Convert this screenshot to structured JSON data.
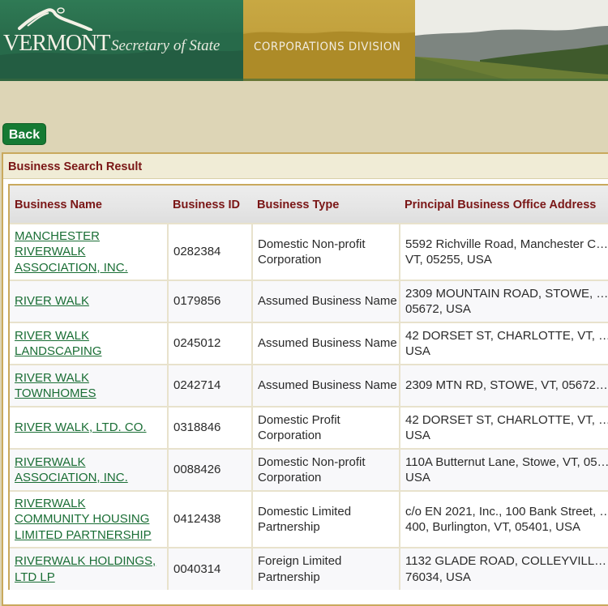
{
  "banner": {
    "state_name": "VERMONT",
    "office_name": "Secretary of State",
    "division_name": "CORPORATIONS DIVISION",
    "logo_icon": "mountain-logo-icon",
    "scenery": "mountain-landscape-image"
  },
  "toolbar": {
    "back_label": "Back"
  },
  "results": {
    "title": "Business Search Result",
    "columns": [
      "Business Name",
      "Business ID",
      "Business Type",
      "Principal Business Office Address"
    ],
    "rows": [
      {
        "name": "MANCHESTER RIVERWALK ASSOCIATION, INC.",
        "id": "0282384",
        "type": "Domestic Non-profit Corporation",
        "address": "5592 Richville Road, Manchester C… VT, 05255, USA"
      },
      {
        "name": "RIVER WALK",
        "id": "0179856",
        "type": "Assumed Business Name",
        "address": "2309 MOUNTAIN ROAD, STOWE, … 05672, USA"
      },
      {
        "name": "RIVER WALK LANDSCAPING",
        "id": "0245012",
        "type": "Assumed Business Name",
        "address": "42 DORSET ST, CHARLOTTE, VT, … USA"
      },
      {
        "name": "RIVER WALK TOWNHOMES",
        "id": "0242714",
        "type": "Assumed Business Name",
        "address": "2309 MTN RD, STOWE, VT, 05672…"
      },
      {
        "name": "RIVER WALK, LTD. CO.",
        "id": "0318846",
        "type": "Domestic Profit Corporation",
        "address": "42 DORSET ST, CHARLOTTE, VT, … USA"
      },
      {
        "name": "RIVERWALK ASSOCIATION, INC.",
        "id": "0088426",
        "type": "Domestic Non-profit Corporation",
        "address": "110A Butternut Lane, Stowe, VT, 05… USA"
      },
      {
        "name": "RIVERWALK COMMUNITY HOUSING LIMITED PARTNERSHIP",
        "id": "0412438",
        "type": "Domestic Limited Partnership",
        "address": "c/o EN 2021, Inc., 100 Bank Street, … 400, Burlington, VT, 05401, USA"
      },
      {
        "name": "RIVERWALK HOLDINGS, LTD LP",
        "id": "0040314",
        "type": "Foreign Limited Partnership",
        "address": "1132 GLADE ROAD, COLLEYVILL… 76034, USA"
      }
    ]
  }
}
